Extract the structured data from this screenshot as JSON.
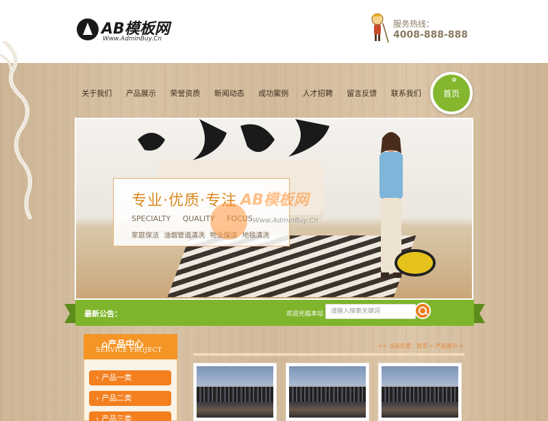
{
  "header": {
    "logo_text": "AB模板网",
    "logo_sub": "Www.AdminBuy.Cn",
    "hotline_label": "服务热线：",
    "hotline_number": "4008-888-888"
  },
  "nav": {
    "items": [
      "关于我们",
      "产品展示",
      "荣誉资质",
      "新闻动态",
      "成功案例",
      "人才招聘",
      "留言反馈",
      "联系我们"
    ],
    "home_label": "首页"
  },
  "banner": {
    "tagline": "专业·优质·专注",
    "tagline_en": "SPECIALTY QUALITY FOCUS",
    "services": "家庭保洁 油烟管道清洗 物业保洁 地毯清洗",
    "watermark": "AB模板网",
    "watermark_url": "Www.AdminBuy.Cn"
  },
  "notice": {
    "label": "最新公告：",
    "search_label": "欢迎光临本站",
    "search_placeholder": "请输入搜索关键词"
  },
  "sidebar": {
    "title_cn": "产品中心",
    "title_en": "SERVICE PROJECT",
    "items": [
      "产品一类",
      "产品二类",
      "产品三类"
    ]
  },
  "content": {
    "breadcrumb": ">> 当前位置：首页 > 产品展示 >"
  },
  "colors": {
    "accent_green": "#7eb52b",
    "accent_orange": "#f37f1f",
    "wood": "#d4bd9e"
  }
}
